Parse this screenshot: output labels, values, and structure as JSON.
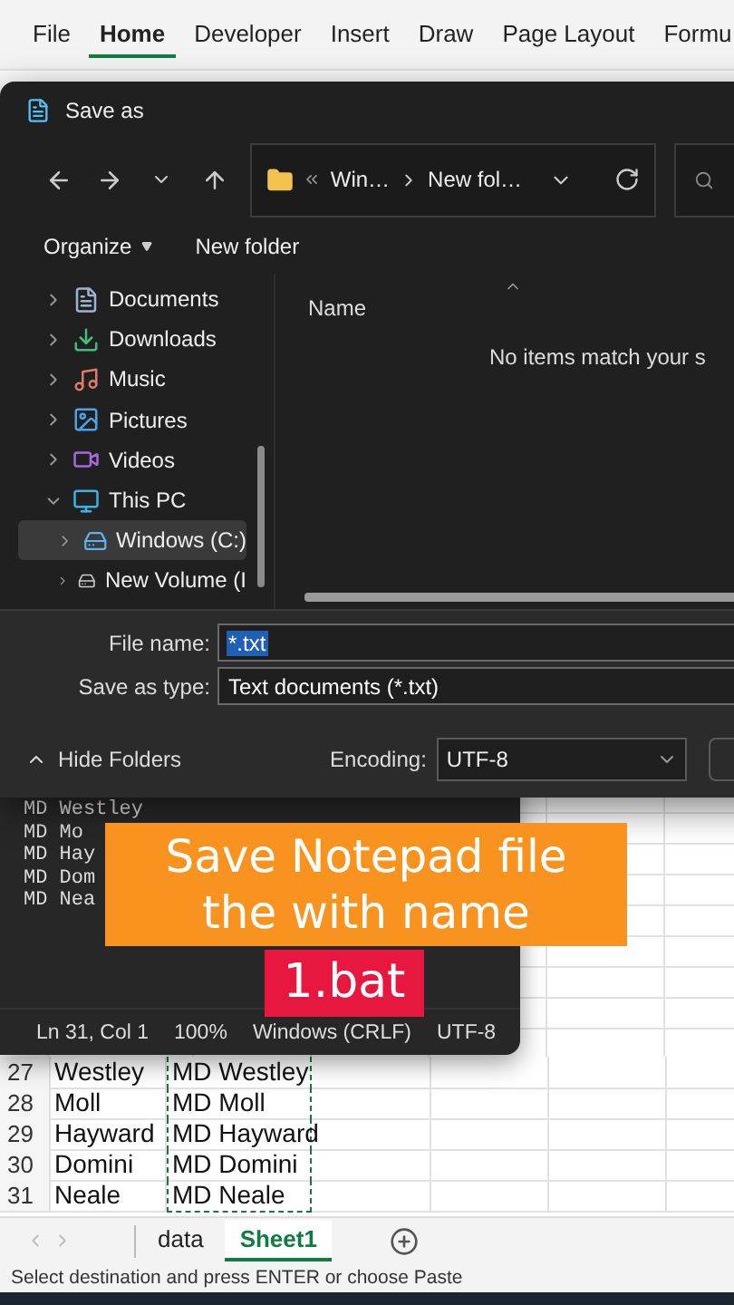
{
  "excel": {
    "ribbon_tabs": [
      {
        "label": "File",
        "selected": false
      },
      {
        "label": "Home",
        "selected": true
      },
      {
        "label": "Developer",
        "selected": false
      },
      {
        "label": "Insert",
        "selected": false
      },
      {
        "label": "Draw",
        "selected": false
      },
      {
        "label": "Page Layout",
        "selected": false
      },
      {
        "label": "Formu",
        "selected": false
      }
    ],
    "rows": [
      {
        "number": "27",
        "column_a": "Westley",
        "column_b": "MD Westley"
      },
      {
        "number": "28",
        "column_a": "Moll",
        "column_b": "MD Moll"
      },
      {
        "number": "29",
        "column_a": "Hayward",
        "column_b": "MD Hayward"
      },
      {
        "number": "30",
        "column_a": "Domini",
        "column_b": "MD Domini"
      },
      {
        "number": "31",
        "column_a": "Neale",
        "column_b": "MD Neale"
      }
    ],
    "sheet_tabs": [
      {
        "label": "data",
        "selected": false
      },
      {
        "label": "Sheet1",
        "selected": true
      }
    ],
    "status_bar": "Select destination and press ENTER or choose Paste"
  },
  "notepad": {
    "lines": [
      "MD Westley",
      "MD Mo",
      "MD Hay",
      "MD Dom",
      "MD Nea"
    ],
    "status": [
      "Ln 31, Col 1",
      "100%",
      "Windows (CRLF)",
      "UTF-8"
    ]
  },
  "dialog": {
    "title": "Save as",
    "path": [
      "Win…",
      "New fol…"
    ],
    "toolbar": [
      "Organize",
      "New folder"
    ],
    "nav_items": [
      {
        "label": "Documents",
        "kind": "documents",
        "expanded": false,
        "selected": false
      },
      {
        "label": "Downloads",
        "kind": "downloads",
        "expanded": false,
        "selected": false
      },
      {
        "label": "Music",
        "kind": "music",
        "expanded": false,
        "selected": false
      },
      {
        "label": "Pictures",
        "kind": "pictures",
        "expanded": false,
        "selected": false
      },
      {
        "label": "Videos",
        "kind": "videos",
        "expanded": false,
        "selected": false
      },
      {
        "label": "This PC",
        "kind": "pc",
        "expanded": true,
        "selected": false,
        "children": [
          {
            "label": "Windows (C:)",
            "kind": "system-drive",
            "expanded": false,
            "selected": true
          },
          {
            "label": "New Volume (I",
            "kind": "drive",
            "expanded": false,
            "selected": false
          }
        ]
      }
    ],
    "column": "Name",
    "empty_message": "No items match your s",
    "file_name_label": "File name:",
    "file_name": "*.txt",
    "file_name_selected": true,
    "save_as_type_label": "Save as type:",
    "save_as_type": "Text documents (*.txt)",
    "hide_folders": "Hide Folders",
    "encoding_label": "Encoding:",
    "encoding": "UTF-8"
  },
  "caption": {
    "lines": [
      "Save Notepad file",
      "the with name"
    ],
    "highlight": "1.bat"
  }
}
